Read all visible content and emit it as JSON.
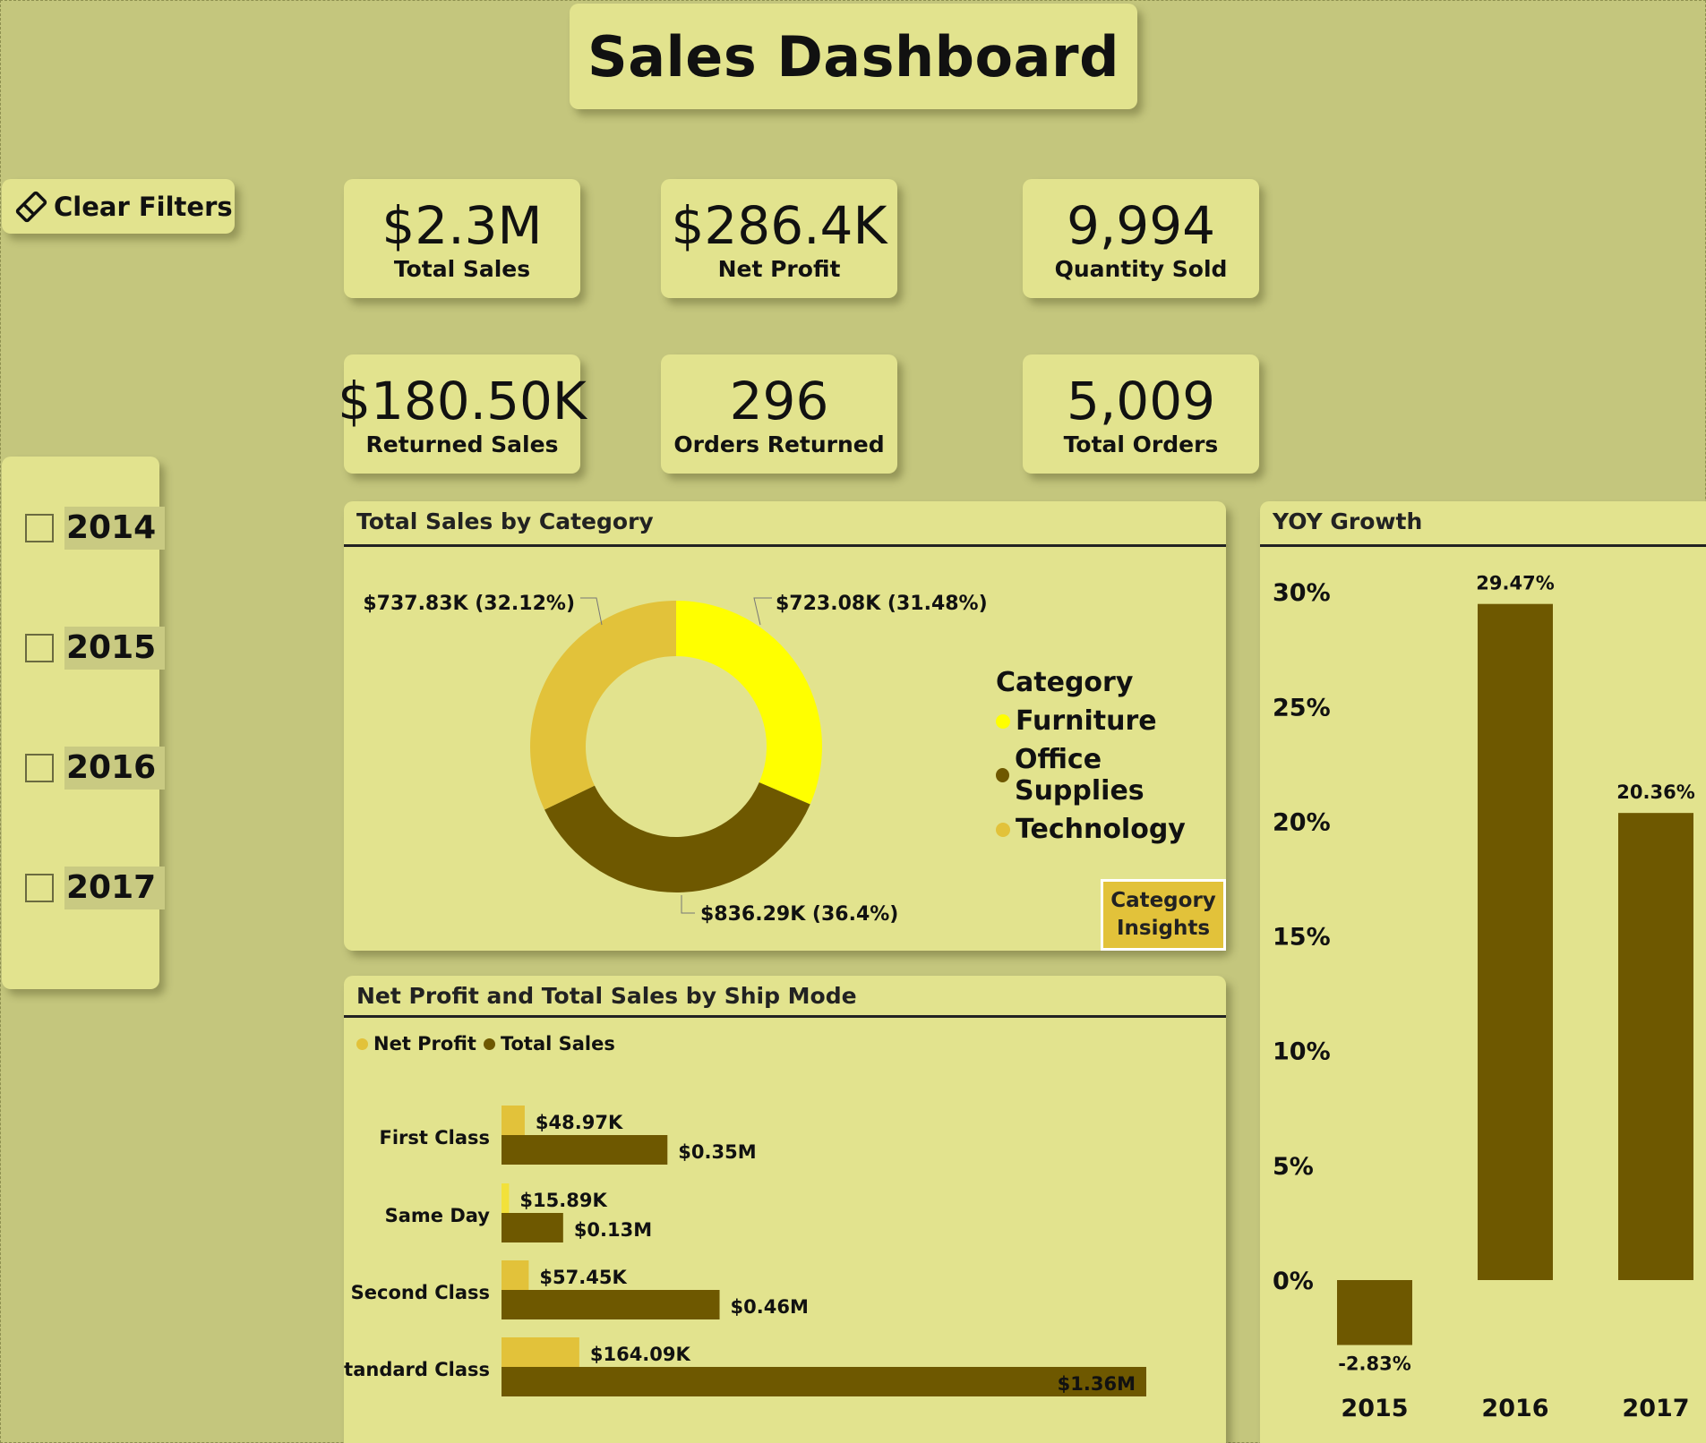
{
  "title": "Sales Dashboard",
  "clear_filters": {
    "label": "Clear Filters",
    "icon": "eraser-icon"
  },
  "kpis": [
    {
      "value": "$2.3M",
      "label": "Total Sales"
    },
    {
      "value": "$286.4K",
      "label": "Net Profit"
    },
    {
      "value": "9,994",
      "label": "Quantity Sold"
    },
    {
      "value": "$180.50K",
      "label": "Returned Sales"
    },
    {
      "value": "296",
      "label": "Orders Returned"
    },
    {
      "value": "5,009",
      "label": "Total Orders"
    }
  ],
  "year_slicer": {
    "items": [
      {
        "label": "2014",
        "checked": false
      },
      {
        "label": "2015",
        "checked": false
      },
      {
        "label": "2016",
        "checked": false
      },
      {
        "label": "2017",
        "checked": false
      }
    ]
  },
  "category_panel": {
    "title": "Total Sales by Category",
    "insights_button": {
      "line1": "Category",
      "line2": "Insights"
    }
  },
  "shipmode_panel": {
    "title": "Net Profit and Total Sales by Ship Mode"
  },
  "yoy_panel": {
    "title": "YOY Growth"
  },
  "colors": {
    "background": "#c4c67d",
    "card": "#e2e38e",
    "furniture": "#ffff00",
    "office_supplies": "#6e5800",
    "technology": "#e2c23a",
    "net_profit": "#e2c23a",
    "total_sales": "#6e5800"
  },
  "chart_data": [
    {
      "type": "pie",
      "title": "Total Sales by Category",
      "legend_title": "Category",
      "legend_position": "right",
      "slices": [
        {
          "name": "Furniture",
          "value": 723.08,
          "label": "$723.08K (31.48%)",
          "color": "#ffff00"
        },
        {
          "name": "Office Supplies",
          "value": 836.29,
          "label": "$836.29K (36.4%)",
          "color": "#6e5800"
        },
        {
          "name": "Technology",
          "value": 737.83,
          "label": "$737.83K (32.12%)",
          "color": "#e2c23a"
        }
      ]
    },
    {
      "type": "bar",
      "orientation": "horizontal",
      "title": "Net Profit and Total Sales by Ship Mode",
      "legend_position": "top-left",
      "categories": [
        "First Class",
        "Same Day",
        "Second Class",
        "Standard Class"
      ],
      "series": [
        {
          "name": "Net Profit",
          "values": [
            0.04897,
            0.01589,
            0.05745,
            0.16409
          ],
          "labels": [
            "$48.97K",
            "$15.89K",
            "$57.45K",
            "$164.09K"
          ],
          "color": "#e2c23a"
        },
        {
          "name": "Total Sales",
          "values": [
            0.35,
            0.13,
            0.46,
            1.36
          ],
          "labels": [
            "$0.35M",
            "$0.13M",
            "$0.46M",
            "$1.36M"
          ],
          "color": "#6e5800"
        }
      ],
      "xlim": [
        0,
        1.36
      ]
    },
    {
      "type": "bar",
      "title": "YOY Growth",
      "categories": [
        "2015",
        "2016",
        "2017"
      ],
      "values": [
        -2.83,
        29.47,
        20.36
      ],
      "labels": [
        "-2.83%",
        "29.47%",
        "20.36%"
      ],
      "ylim": [
        -2.83,
        30
      ],
      "yticks": [
        "0%",
        "5%",
        "10%",
        "15%",
        "20%",
        "25%",
        "30%"
      ],
      "color": "#6e5800",
      "grid": false
    }
  ]
}
